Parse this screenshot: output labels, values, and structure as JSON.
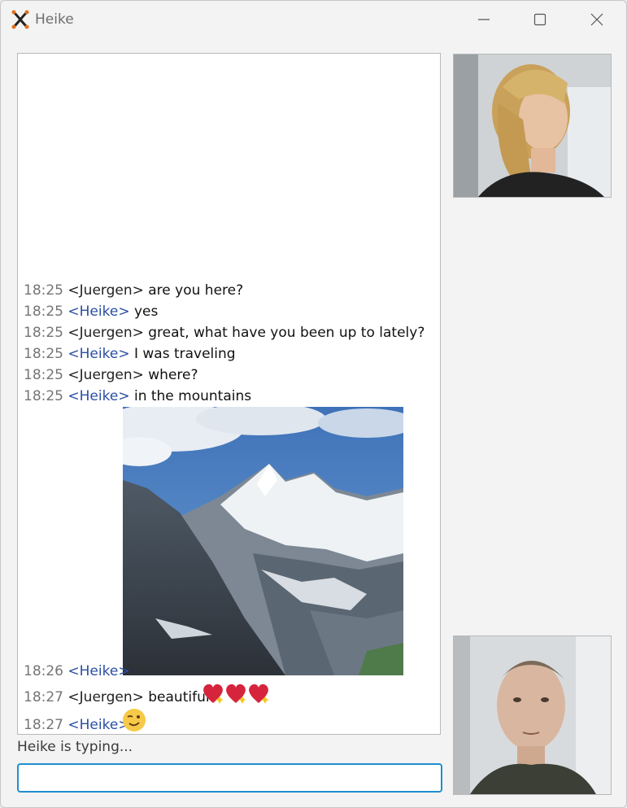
{
  "window": {
    "title": "Heike",
    "logo_icon": "x-logo-icon",
    "controls": {
      "minimize": "minimize-icon",
      "maximize": "maximize-icon",
      "close": "close-icon"
    }
  },
  "chat": {
    "messages": [
      {
        "time": "18:25",
        "nick": "<Juergen>",
        "text": "are you here?"
      },
      {
        "time": "18:25",
        "nick": "<Heike>",
        "text": "yes"
      },
      {
        "time": "18:25",
        "nick": "<Juergen>",
        "text": "great, what have you been up to lately?"
      },
      {
        "time": "18:25",
        "nick": "<Heike>",
        "text": "I was traveling"
      },
      {
        "time": "18:25",
        "nick": "<Juergen>",
        "text": "where?"
      },
      {
        "time": "18:25",
        "nick": "<Heike>",
        "text": "in the mountains"
      },
      {
        "time": "18:26",
        "nick": "<Heike>",
        "text": "",
        "attachment": "mountain-photo"
      },
      {
        "time": "18:27",
        "nick": "<Juergen>",
        "text": "beautiful!",
        "emoji": "sparkling-hearts-emoji"
      },
      {
        "time": "18:27",
        "nick": "<Heike>",
        "text": "",
        "emoji": "winking-face-emoji"
      }
    ]
  },
  "status": {
    "typing": "Heike is typing..."
  },
  "input": {
    "value": "",
    "placeholder": ""
  },
  "video": {
    "remote": "video-remote",
    "local": "video-local"
  },
  "colors": {
    "accent": "#1e8fd0",
    "heike_nick": "#2b4fa3",
    "timestamp": "#757575",
    "logo": "#e07020"
  }
}
